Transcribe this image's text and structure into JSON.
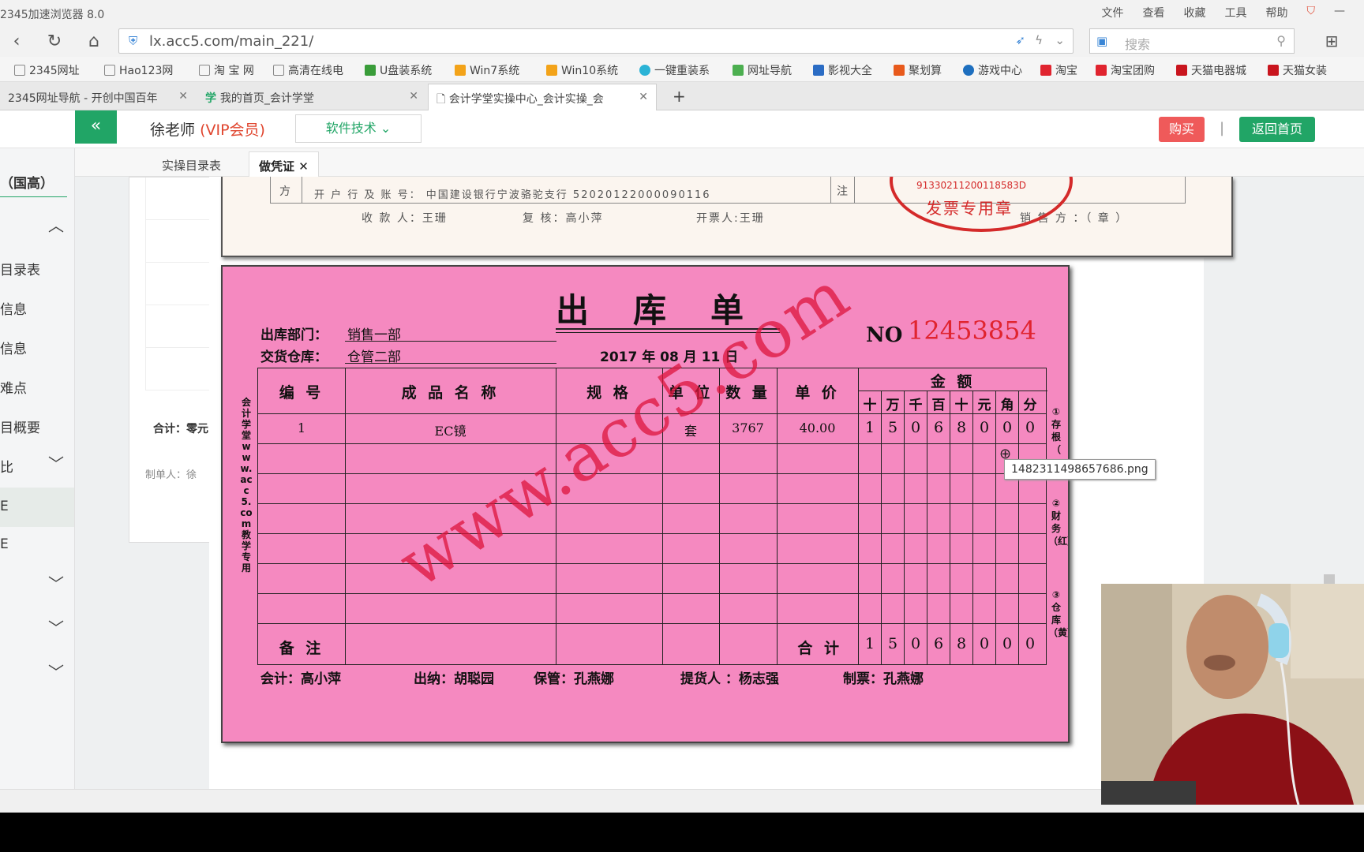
{
  "browser": {
    "app_title": "2345加速浏览器 8.0",
    "menu": [
      "文件",
      "查看",
      "收藏",
      "工具",
      "帮助"
    ],
    "url": "lx.acc5.com/main_221/",
    "search_placeholder": "搜索",
    "bookmarks": [
      "2345网址",
      "Hao123网",
      "淘 宝 网",
      "高清在线电",
      "U盘装系统",
      "Win7系统",
      "Win10系统",
      "一键重装系",
      "网址导航",
      "影视大全",
      "聚划算",
      "游戏中心",
      "淘宝",
      "淘宝团购",
      "天猫电器城",
      "天猫女装"
    ],
    "tabs": [
      {
        "label": "2345网址导航 - 开创中国百年"
      },
      {
        "label": "我的首页_会计学堂"
      },
      {
        "label": "会计学堂实操中心_会计实操_会"
      }
    ],
    "new_tab": "+"
  },
  "header": {
    "collapse": "«",
    "user_name": "徐老师",
    "user_level": "(VIP会员)",
    "menu_label": "软件技术",
    "buy": "购买",
    "separator": "|",
    "home": "返回首页"
  },
  "sidebar": {
    "items": [
      {
        "label": "（国高）"
      },
      {
        "label": ""
      },
      {
        "label": "目录表"
      },
      {
        "label": "信息"
      },
      {
        "label": "信息"
      },
      {
        "label": "难点"
      },
      {
        "label": "目概要"
      },
      {
        "label": "比"
      },
      {
        "label": "E"
      },
      {
        "label": "E"
      },
      {
        "label": ""
      },
      {
        "label": ""
      },
      {
        "label": ""
      }
    ]
  },
  "subtabs": {
    "catalog": "实操目录表",
    "voucher": "做凭证"
  },
  "left_card": {
    "total": "合计：零元",
    "maker": "制单人：徐"
  },
  "invoice": {
    "label_fang": "方",
    "bank": "开 户 行 及 账 号： 中国建设银行宁波骆驼支行 52020122000090116",
    "note": "注",
    "payee": "收 款 人：王珊",
    "reviewer": "复 核：高小萍",
    "issuer": "开票人:王珊",
    "seller": "销 售 方 ：（ 章 ）",
    "seal_number": "91330211200118583D",
    "seal_text": "发票专用章"
  },
  "form": {
    "title": "出库单",
    "dept_label": "出库部门：",
    "dept_value": "销售一部",
    "warehouse_label": "交货仓库：",
    "warehouse_value": "仓管二部",
    "no_label": "NO",
    "no_value": "12453854",
    "date": "2017 年 08 月 11 日",
    "columns": [
      "编 号",
      "成 品 名 称",
      "规 格",
      "单 位",
      "数 量",
      "单 价"
    ],
    "amount_header": "金  额",
    "digit_headers": [
      "十",
      "万",
      "千",
      "百",
      "十",
      "元",
      "角",
      "分"
    ],
    "rows": [
      {
        "no": "1",
        "name": "EC镜",
        "spec": "",
        "unit": "套",
        "qty": "3767",
        "price": "40.00",
        "digits": [
          "1",
          "5",
          "0",
          "6",
          "8",
          "0",
          "0",
          "0"
        ]
      }
    ],
    "remark_label": "备 注",
    "total_label": "合 计",
    "total_digits": [
      "1",
      "5",
      "0",
      "6",
      "8",
      "0",
      "0",
      "0"
    ],
    "left_vertical": "会计学堂www.acc5.com教学专用",
    "right_copy1": "①存根（",
    "right_copy2": "②财务（红）",
    "right_copy3": "③仓库（黄）",
    "accountant": "会计：高小萍",
    "cashier": "出纳：胡聪园",
    "keeper": "保管：孔燕娜",
    "picker": "提货人 ：杨志强",
    "biller": "制票：孔燕娜",
    "watermark": "www.acc5.com"
  },
  "tooltip": "1482311498657686.png",
  "colors": {
    "accent": "#21a566",
    "buy": "#ef5a5a",
    "form_bg": "#f589c0",
    "no_red": "#e0242f"
  }
}
